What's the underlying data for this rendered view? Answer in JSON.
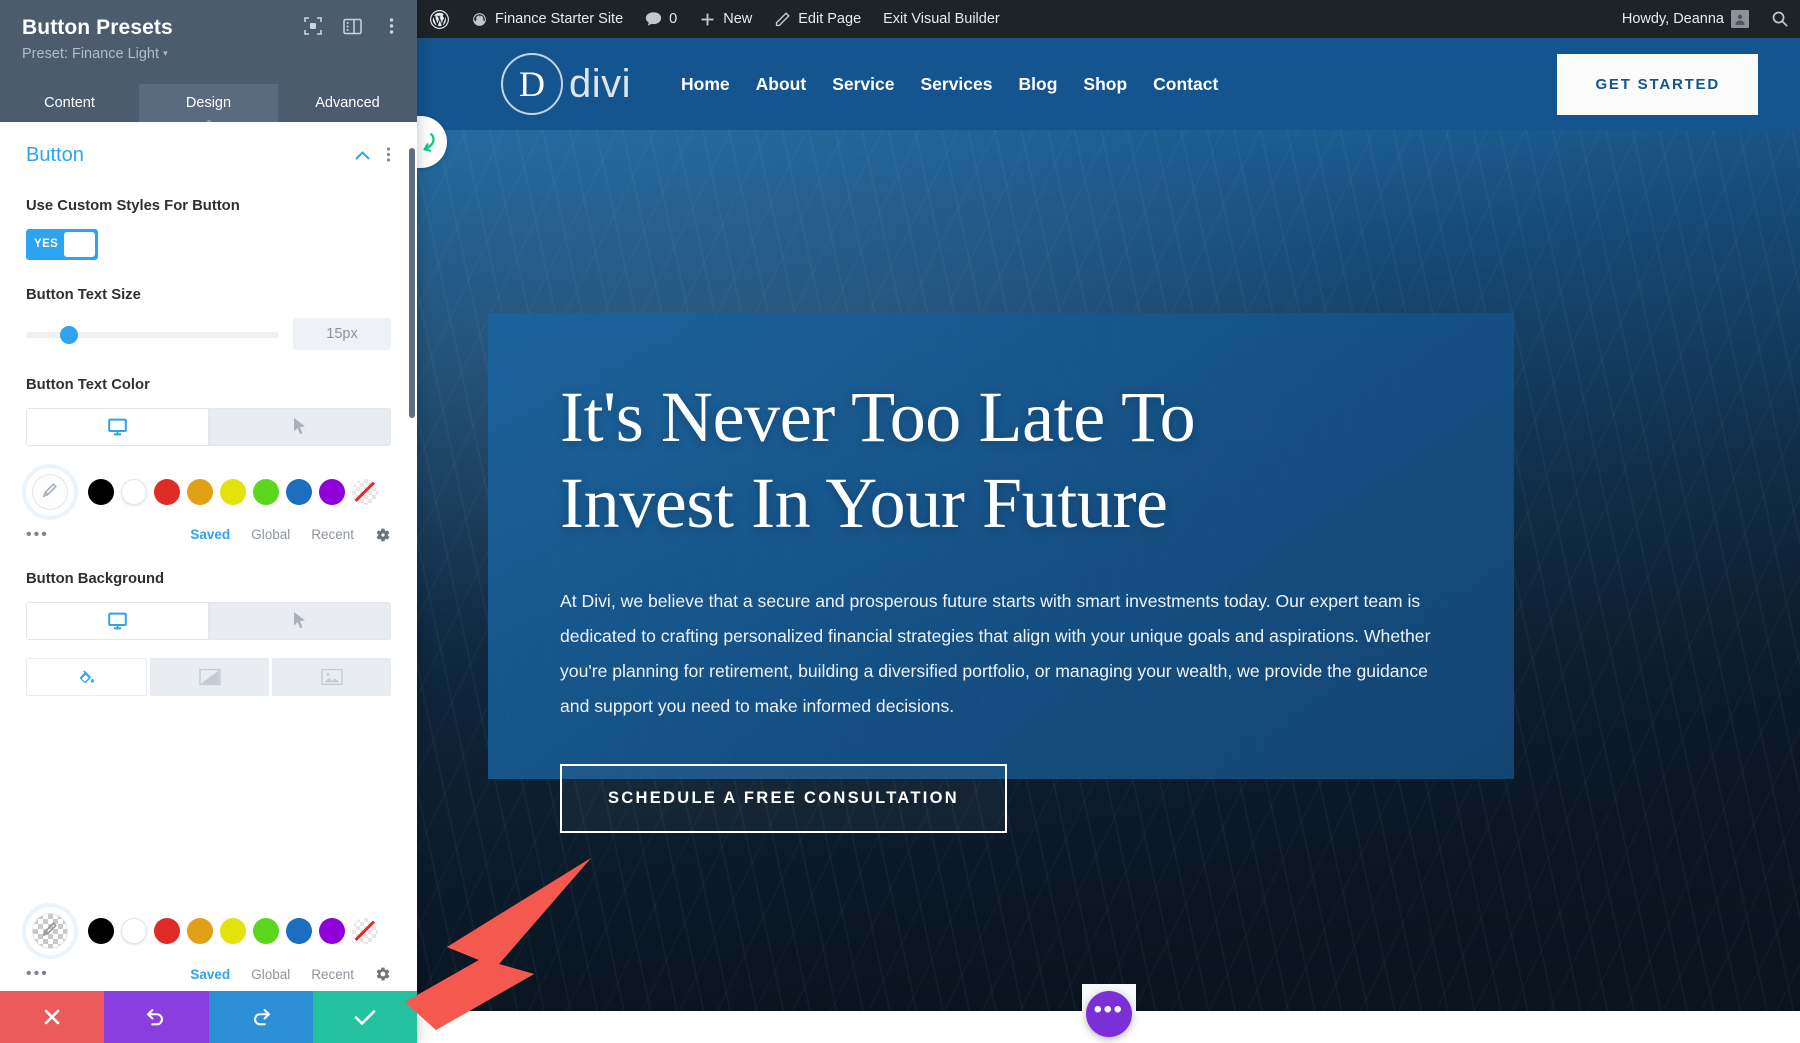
{
  "settings_panel": {
    "title": "Button Presets",
    "subtitle": "Preset: Finance Light",
    "subtitle_caret": "▾",
    "head_icons": [
      "focus-target-icon",
      "panel-layout-icon",
      "kebab-menu-icon"
    ],
    "tabs": [
      {
        "label": "Content",
        "active": false
      },
      {
        "label": "Design",
        "active": true
      },
      {
        "label": "Advanced",
        "active": false
      }
    ],
    "section": {
      "title": "Button",
      "collapse_icon": "chevron-up-icon",
      "menu_icon": "kebab-menu-icon"
    },
    "fields": {
      "custom_styles": {
        "label": "Use Custom Styles For Button",
        "toggle_value": "YES"
      },
      "text_size": {
        "label": "Button Text Size",
        "value": "15px",
        "slider_percent": 17
      },
      "text_color": {
        "label": "Button Text Color",
        "device_tabs": [
          "desktop-icon",
          "hover-cursor-icon"
        ],
        "active_device_index": 0
      },
      "background": {
        "label": "Button Background",
        "device_tabs": [
          "desktop-icon",
          "hover-cursor-icon"
        ],
        "active_device_index": 0,
        "bg_tabs": [
          "paint-bucket-icon",
          "gradient-icon",
          "image-icon"
        ],
        "active_bg_index": 0
      }
    },
    "palette": {
      "swatches": [
        "#000000",
        "#ffffff",
        "#e02b27",
        "#e2a114",
        "#e3e30b",
        "#5cd51f",
        "#1a6fc0",
        "#9000d8"
      ],
      "none_swatch": "transparent",
      "more_label": "•••",
      "links": [
        {
          "label": "Saved",
          "active": true
        },
        {
          "label": "Global",
          "active": false
        },
        {
          "label": "Recent",
          "active": false
        }
      ],
      "settings_icon": "gear-icon"
    },
    "action_bar": [
      {
        "name": "cancel",
        "icon": "close-x-icon",
        "color": "#eb5b5b"
      },
      {
        "name": "undo",
        "icon": "undo-arrow-icon",
        "color": "#8b3ee0"
      },
      {
        "name": "redo",
        "icon": "redo-arrow-icon",
        "color": "#2d8fd5"
      },
      {
        "name": "save",
        "icon": "checkmark-icon",
        "color": "#25c2a0"
      }
    ]
  },
  "admin_bar": {
    "wp_logo": "wordpress-logo-icon",
    "site_name": "Finance Starter Site",
    "site_icon": "dashboard-speedometer-icon",
    "comments_icon": "comment-bubble-icon",
    "comments_count": "0",
    "new_icon": "plus-icon",
    "new_label": "New",
    "edit_icon": "pencil-icon",
    "edit_label": "Edit Page",
    "exit_label": "Exit Visual Builder",
    "greeting": "Howdy, Deanna",
    "avatar": "user-avatar",
    "search_icon": "search-icon"
  },
  "website": {
    "return_tab_icon": "return-arrow-icon",
    "logo": {
      "mark": "D",
      "word": "divi"
    },
    "nav": [
      "Home",
      "About",
      "Service",
      "Services",
      "Blog",
      "Shop",
      "Contact"
    ],
    "header_cta": "GET STARTED",
    "hero": {
      "heading_line1": "It's Never Too Late To",
      "heading_line2": "Invest In Your Future",
      "paragraph": "At Divi, we believe that a secure and prosperous future starts with smart investments today. Our expert team is dedicated to crafting personalized financial strategies that align with your unique goals and aspirations. Whether you're planning for retirement, building a diversified portfolio, or managing your wealth, we provide the guidance and support you need to make informed decisions.",
      "cta": "SCHEDULE A FREE CONSULTATION",
      "scroll_icon": "arrow-down-icon"
    },
    "fab_icon": "ellipsis-icon",
    "fab_label": "•••"
  },
  "annotation": {
    "arrow_color": "#f4594f",
    "arrow_name": "pointer-arrow-annotation"
  },
  "colors": {
    "panel_header": "#4c5b6e",
    "accent_blue": "#2ea3f2",
    "site_blue": "#14548f",
    "admin_bar": "#1d2327"
  }
}
